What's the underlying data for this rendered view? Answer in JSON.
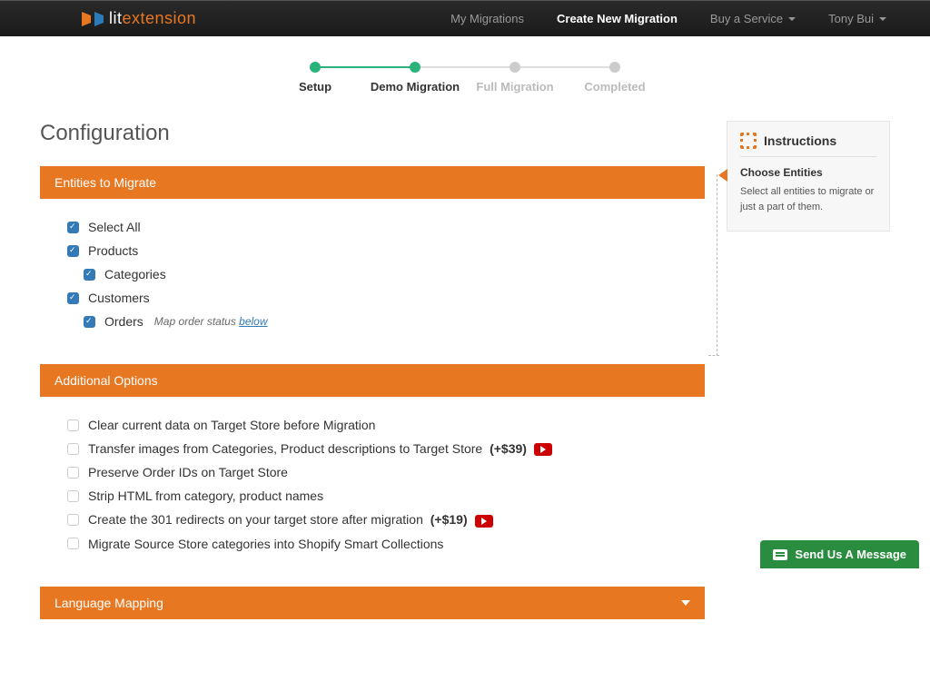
{
  "header": {
    "logo_text_a": "lit",
    "logo_text_b": "extension",
    "nav": {
      "my_migrations": "My Migrations",
      "create_new": "Create New Migration",
      "buy_service": "Buy a Service",
      "user": "Tony Bui"
    }
  },
  "stepper": {
    "setup": "Setup",
    "demo": "Demo Migration",
    "full": "Full Migration",
    "completed": "Completed"
  },
  "page_title": "Configuration",
  "entities_panel": {
    "title": "Entities to Migrate",
    "select_all": "Select All",
    "products": "Products",
    "categories": "Categories",
    "customers": "Customers",
    "orders": "Orders",
    "orders_hint_a": "Map order status ",
    "orders_hint_link": "below"
  },
  "options_panel": {
    "title": "Additional Options",
    "opt1": "Clear current data on Target Store before Migration",
    "opt2_a": "Transfer images from Categories, Product descriptions to Target Store ",
    "opt2_b": "(+$39)",
    "opt3": "Preserve Order IDs on Target Store",
    "opt4": "Strip HTML from category, product names",
    "opt5_a": "Create the 301 redirects on your target store after migration ",
    "opt5_b": "(+$19)",
    "opt6": "Migrate Source Store categories into Shopify Smart Collections"
  },
  "language_panel": {
    "title": "Language Mapping"
  },
  "instructions": {
    "title": "Instructions",
    "sub": "Choose Entities",
    "text": "Select all entities to migrate or just a part of them."
  },
  "chat": {
    "label": "Send Us A Message"
  }
}
